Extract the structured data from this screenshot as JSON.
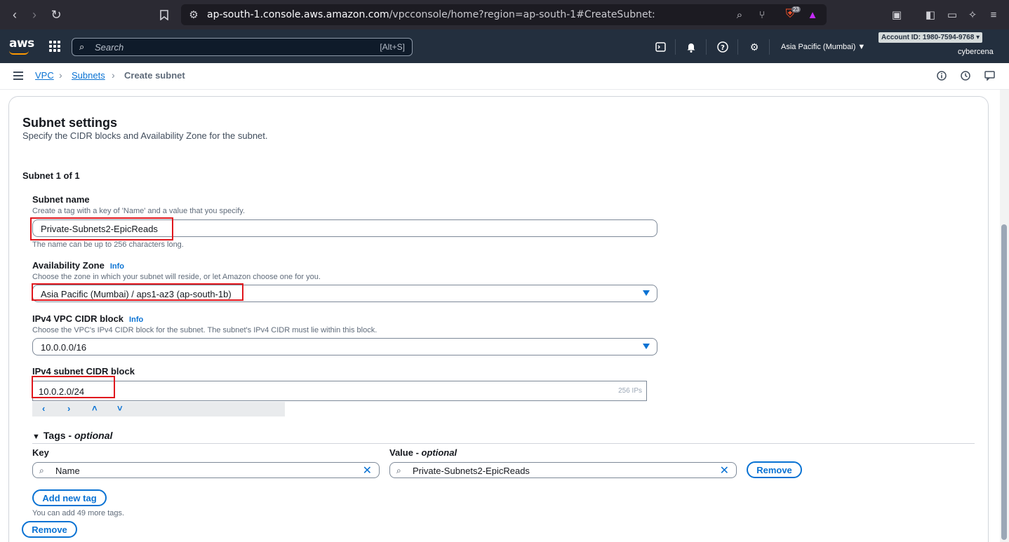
{
  "browser": {
    "url_host": "ap-south-1.console.aws.amazon.com",
    "url_rest": "/vpcconsole/home?region=ap-south-1#CreateSubnet:",
    "shield_count": "23"
  },
  "aws_header": {
    "logo": "aws",
    "search_placeholder": "Search",
    "search_shortcut": "[Alt+S]",
    "region": "Asia Pacific (Mumbai) ▼",
    "account_id": "Account ID: 1980-7594-9768 ▾",
    "username": "cybercena"
  },
  "breadcrumb": {
    "items": [
      "VPC",
      "Subnets",
      "Create subnet"
    ]
  },
  "section": {
    "title": "Subnet settings",
    "description": "Specify the CIDR blocks and Availability Zone for the subnet.",
    "subnet_count": "Subnet 1 of 1"
  },
  "subnet_name": {
    "label": "Subnet name",
    "description": "Create a tag with a key of 'Name' and a value that you specify.",
    "value": "Private-Subnets2-EpicReads",
    "constraint": "The name can be up to 256 characters long."
  },
  "availability_zone": {
    "label": "Availability Zone",
    "info": "Info",
    "description": "Choose the zone in which your subnet will reside, or let Amazon choose one for you.",
    "value": "Asia Pacific (Mumbai) / aps1-az3 (ap-south-1b)"
  },
  "vpc_cidr": {
    "label": "IPv4 VPC CIDR block",
    "info": "Info",
    "description": "Choose the VPC's IPv4 CIDR block for the subnet. The subnet's IPv4 CIDR must lie within this block.",
    "value": "10.0.0.0/16"
  },
  "subnet_cidr": {
    "label": "IPv4 subnet CIDR block",
    "value": "10.0.2.0/24",
    "hint": "256 IPs",
    "arrows": [
      "‹",
      "›",
      "˄",
      "˅"
    ]
  },
  "tags": {
    "header": "Tags - ",
    "header_optional": "optional",
    "key_label": "Key",
    "value_label": "Value - ",
    "value_label_optional": "optional",
    "key_value": "Name",
    "value_value": "Private-Subnets2-EpicReads",
    "remove_label": "Remove",
    "add_label": "Add new tag",
    "note": "You can add 49 more tags."
  },
  "remove_subnet_label": "Remove",
  "colors": {
    "accent": "#0972d3",
    "highlight": "#e0171d",
    "header_bg": "#232f3e"
  }
}
